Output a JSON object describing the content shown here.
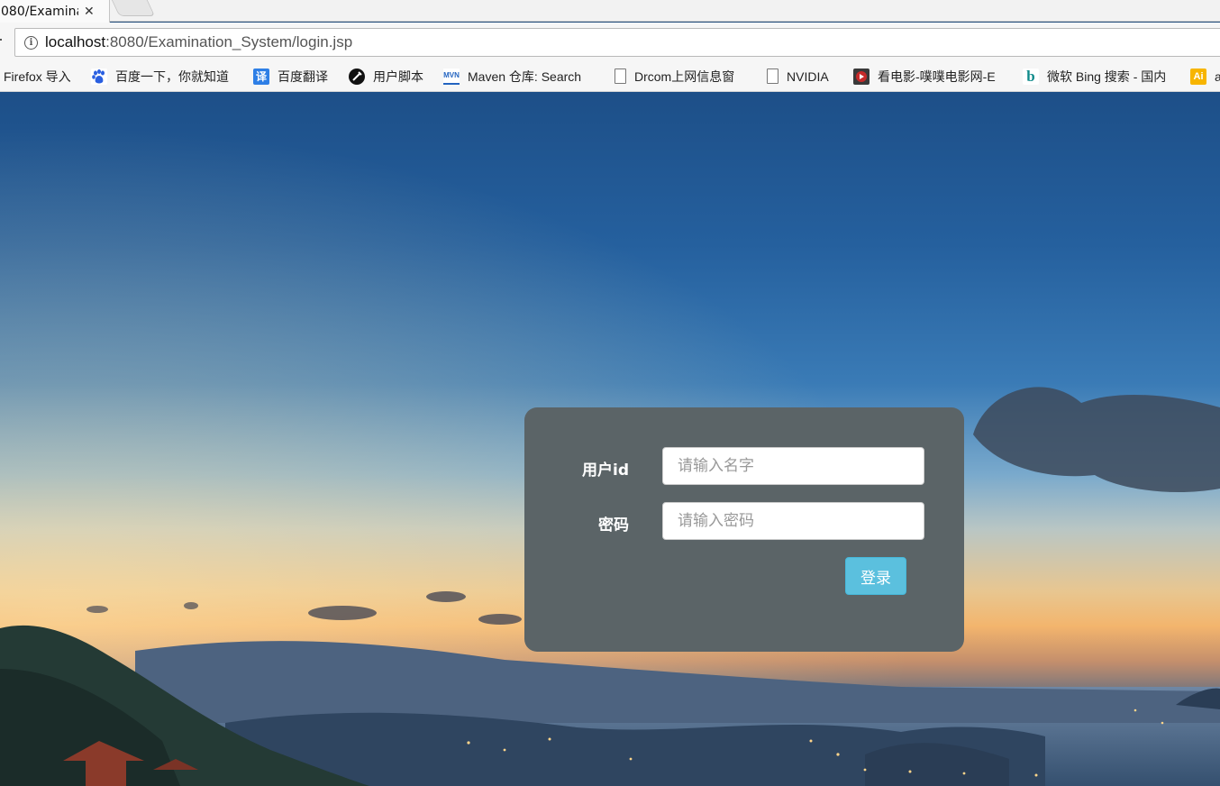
{
  "browser": {
    "tab": {
      "title": "080/Examina",
      "close_glyph": "✕"
    },
    "address_bar": {
      "host": "localhost",
      "path": ":8080/Examination_System/login.jsp"
    },
    "bookmarks": [
      {
        "label": "Firefox 导入",
        "icon": "none"
      },
      {
        "label": "百度一下，你就知道",
        "icon": "baidu-paw-icon"
      },
      {
        "label": "百度翻译",
        "icon": "fanyi-icon"
      },
      {
        "label": "用户脚本",
        "icon": "userscript-icon"
      },
      {
        "label": "Maven 仓库: Search",
        "icon": "mvn-icon"
      },
      {
        "label": "Drcom上网信息窗",
        "icon": "page-icon"
      },
      {
        "label": "NVIDIA",
        "icon": "page-icon"
      },
      {
        "label": "看电影-噗噗电影网-E",
        "icon": "movie-icon"
      },
      {
        "label": "微软 Bing 搜索 - 国内",
        "icon": "bing-icon"
      },
      {
        "label": "a",
        "icon": "ai-icon"
      }
    ],
    "icon_glyphs": {
      "fanyi": "译",
      "mvn": "MVN",
      "bing": "b",
      "ai": "Ai",
      "info": "i"
    }
  },
  "login": {
    "username_label": "用户id",
    "username_placeholder": "请输入名字",
    "password_label": "密码",
    "password_placeholder": "请输入密码",
    "submit_label": "登录"
  },
  "colors": {
    "panel_bg": "#5b6467",
    "button_bg": "#5bc0de",
    "sky_top": "#1d4f88",
    "sunset": "#f3b56d"
  }
}
